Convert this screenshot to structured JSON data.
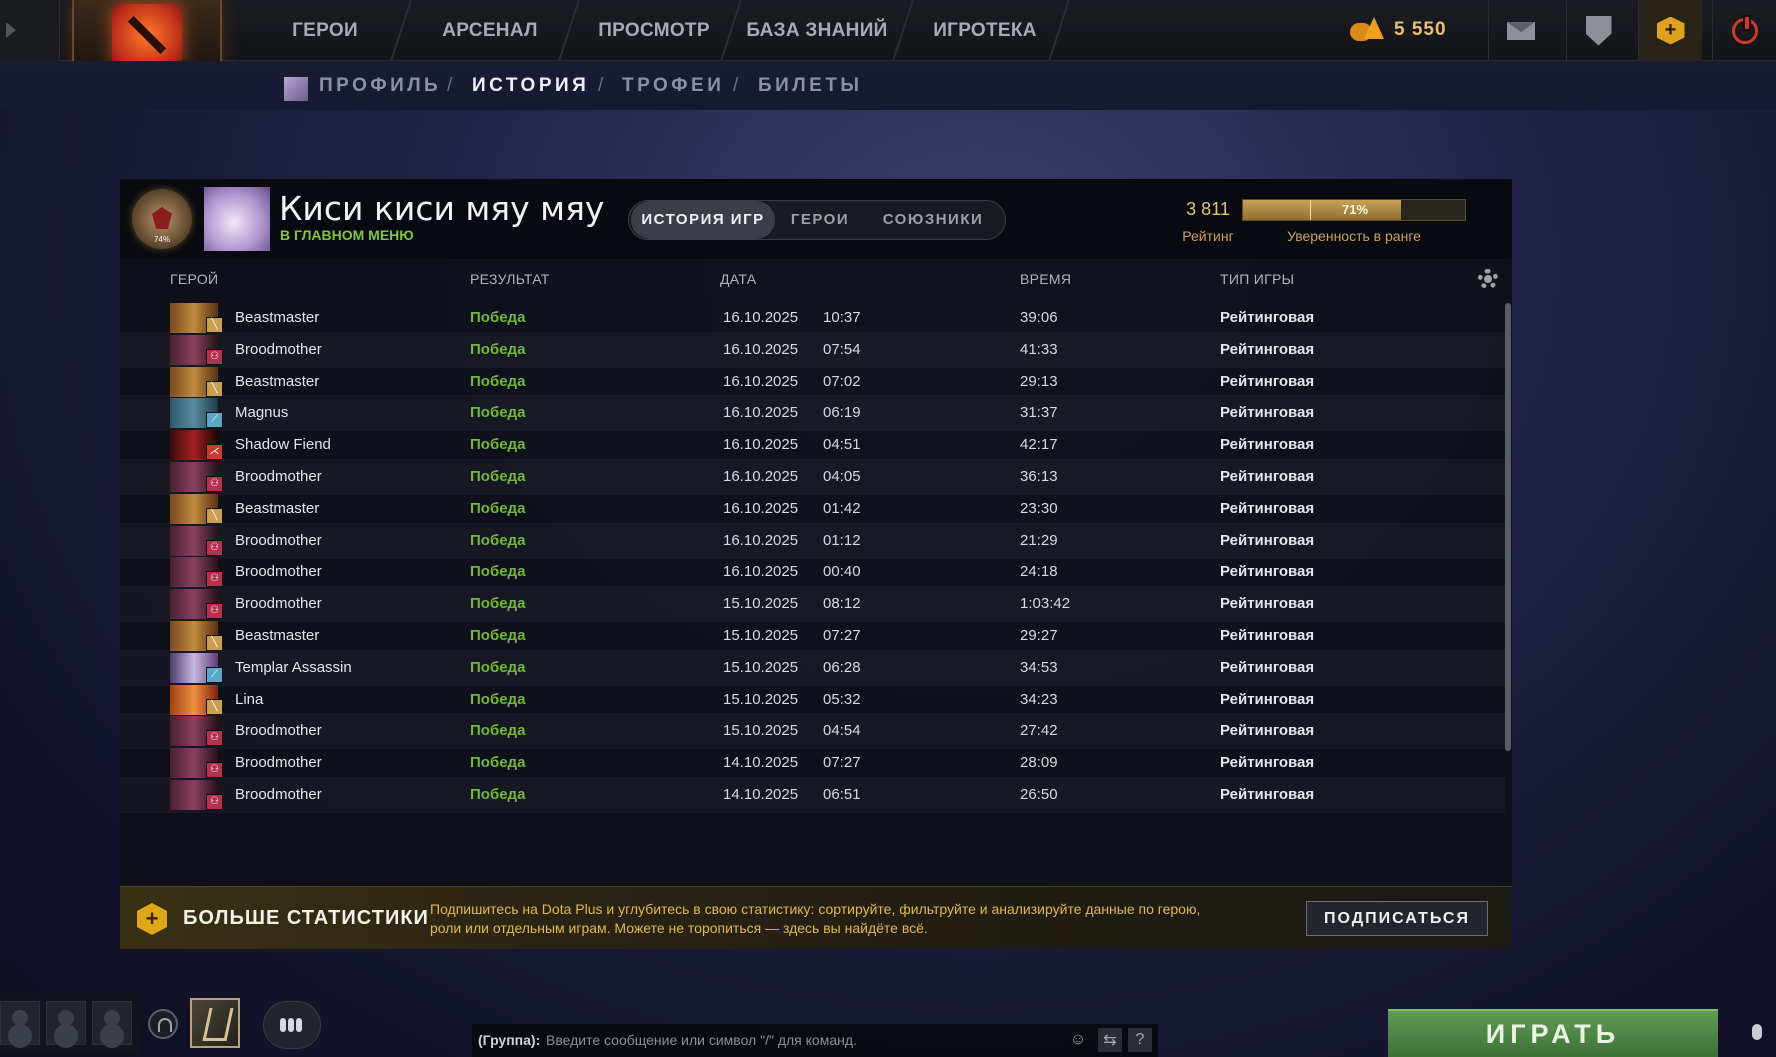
{
  "topnav": {
    "items": [
      "ГЕРОИ",
      "АРСЕНАЛ",
      "ПРОСМОТР",
      "БАЗА ЗНАНИЙ",
      "ИГРОТЕКА"
    ],
    "currency": "5 550"
  },
  "subnav": {
    "items": [
      "ПРОФИЛЬ",
      "ИСТОРИЯ",
      "ТРОФЕИ",
      "БИЛЕТЫ"
    ],
    "separator": "/",
    "active": "ИСТОРИЯ"
  },
  "profile": {
    "name": "Киси киси мяу мяу",
    "status": "В ГЛАВНОМ МЕНЮ",
    "medal_percent": "74%",
    "tabs": [
      "ИСТОРИЯ ИГР",
      "ГЕРОИ",
      "СОЮЗНИКИ"
    ],
    "active_tab": "ИСТОРИЯ ИГР",
    "rating_value": "3 811",
    "rating_label": "Рейтинг",
    "confidence_value": "71%",
    "confidence_fraction": 0.71,
    "confidence_label": "Уверенность в ранге"
  },
  "table": {
    "headers": {
      "hero": "ГЕРОЙ",
      "result": "РЕЗУЛЬТАТ",
      "date": "ДАТА",
      "duration": "ВРЕМЯ",
      "gametype": "ТИП ИГРЫ"
    },
    "rows": [
      {
        "hero": "Beastmaster",
        "result": "Победа",
        "date": "16.10.2025",
        "time": "10:37",
        "duration": "39:06",
        "type": "Рейтинговая"
      },
      {
        "hero": "Broodmother",
        "result": "Победа",
        "date": "16.10.2025",
        "time": "07:54",
        "duration": "41:33",
        "type": "Рейтинговая"
      },
      {
        "hero": "Beastmaster",
        "result": "Победа",
        "date": "16.10.2025",
        "time": "07:02",
        "duration": "29:13",
        "type": "Рейтинговая"
      },
      {
        "hero": "Magnus",
        "result": "Победа",
        "date": "16.10.2025",
        "time": "06:19",
        "duration": "31:37",
        "type": "Рейтинговая"
      },
      {
        "hero": "Shadow Fiend",
        "result": "Победа",
        "date": "16.10.2025",
        "time": "04:51",
        "duration": "42:17",
        "type": "Рейтинговая"
      },
      {
        "hero": "Broodmother",
        "result": "Победа",
        "date": "16.10.2025",
        "time": "04:05",
        "duration": "36:13",
        "type": "Рейтинговая"
      },
      {
        "hero": "Beastmaster",
        "result": "Победа",
        "date": "16.10.2025",
        "time": "01:42",
        "duration": "23:30",
        "type": "Рейтинговая"
      },
      {
        "hero": "Broodmother",
        "result": "Победа",
        "date": "16.10.2025",
        "time": "01:12",
        "duration": "21:29",
        "type": "Рейтинговая"
      },
      {
        "hero": "Broodmother",
        "result": "Победа",
        "date": "16.10.2025",
        "time": "00:40",
        "duration": "24:18",
        "type": "Рейтинговая"
      },
      {
        "hero": "Broodmother",
        "result": "Победа",
        "date": "15.10.2025",
        "time": "08:12",
        "duration": "1:03:42",
        "type": "Рейтинговая"
      },
      {
        "hero": "Beastmaster",
        "result": "Победа",
        "date": "15.10.2025",
        "time": "07:27",
        "duration": "29:27",
        "type": "Рейтинговая"
      },
      {
        "hero": "Templar Assassin",
        "result": "Победа",
        "date": "15.10.2025",
        "time": "06:28",
        "duration": "34:53",
        "type": "Рейтинговая"
      },
      {
        "hero": "Lina",
        "result": "Победа",
        "date": "15.10.2025",
        "time": "05:32",
        "duration": "34:23",
        "type": "Рейтинговая"
      },
      {
        "hero": "Broodmother",
        "result": "Победа",
        "date": "15.10.2025",
        "time": "04:54",
        "duration": "27:42",
        "type": "Рейтинговая"
      },
      {
        "hero": "Broodmother",
        "result": "Победа",
        "date": "14.10.2025",
        "time": "07:27",
        "duration": "28:09",
        "type": "Рейтинговая"
      },
      {
        "hero": "Broodmother",
        "result": "Победа",
        "date": "14.10.2025",
        "time": "06:51",
        "duration": "26:50",
        "type": "Рейтинговая"
      }
    ]
  },
  "promo": {
    "title": "БОЛЬШЕ СТАТИСТИКИ",
    "text": "Подпишитесь на Dota Plus и углубитесь в свою статистику: сортируйте, фильтруйте и анализируйте данные по герою, роли или отдельным играм. Можете не торопиться — здесь вы найдёте всё.",
    "button": "ПОДПИСАТЬСЯ"
  },
  "chat": {
    "group_label": "(Группа):",
    "placeholder": "Введите сообщение или символ \"/\" для команд.",
    "help": "?"
  },
  "play_button": "ИГРАТЬ",
  "colors": {
    "win": "#6fb83a",
    "gold": "#e3c27a",
    "play": "#4f8a45"
  }
}
